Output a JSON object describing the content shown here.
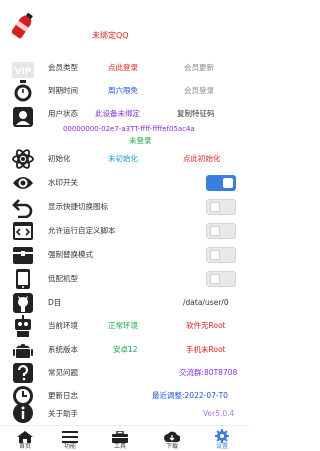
{
  "colors": {
    "red": "#e02020",
    "blue": "#1a56d8",
    "green": "#1aa84a",
    "purple": "#8a2be2",
    "cyan": "#1a9fd8",
    "gray": "#888888",
    "accent": "#3d7de0"
  },
  "header": {
    "user_label": "未绑定QQ",
    "icon": "bottle-icon"
  },
  "membership": {
    "label": "会员类型",
    "value": "点此登录",
    "action": "会员更新",
    "icon": "vip-icon"
  },
  "expiry": {
    "label": "到期时间",
    "value": "周六限免",
    "action": "会员登录",
    "icon": "stopwatch-icon"
  },
  "user_status": {
    "label": "用户状态",
    "value": "此设备未绑定",
    "action": "复制特征码",
    "icon": "user-icon"
  },
  "device_id": {
    "id": "00000000-02e7-a3TT-ffff-ffffef05ac4a",
    "status": "未登录"
  },
  "init": {
    "label": "初始化",
    "value": "未初始化",
    "action": "点此初始化",
    "icon": "atom-icon"
  },
  "toggles": [
    {
      "label": "水印开关",
      "on": true,
      "icon": "eye-icon"
    },
    {
      "label": "显示快捷切换图标",
      "on": false,
      "icon": "undo-icon"
    },
    {
      "label": "允许运行自定义脚本",
      "on": false,
      "icon": "script-icon"
    },
    {
      "label": "强制替换模式",
      "on": false,
      "icon": "box-icon"
    },
    {
      "label": "低配机型",
      "on": false,
      "icon": "phone-icon"
    }
  ],
  "data_path": {
    "label": "D目",
    "value": "/data/user/0",
    "icon": "github-icon"
  },
  "environment": {
    "label": "当前环境",
    "value": "正常环境",
    "extra": "软件无Root",
    "icon": "robot-icon"
  },
  "system": {
    "label": "系统版本",
    "value": "安卓12",
    "extra": "手机未Root",
    "icon": "android-icon"
  },
  "faq": {
    "label": "常见问题",
    "value": "交流群:80T8708",
    "icon": "question-icon"
  },
  "changelog": {
    "label": "更新日志",
    "value": "最近调整:2022-07-T0",
    "icon": "clock-icon"
  },
  "about": {
    "label": "关于助手",
    "value": "Ver5.0.4",
    "icon": "info-icon"
  },
  "nav": [
    {
      "label": "首页",
      "icon": "home-icon"
    },
    {
      "label": "功能",
      "icon": "menu-icon"
    },
    {
      "label": "工具",
      "icon": "toolbox-icon"
    },
    {
      "label": "下载",
      "icon": "cloud-download-icon"
    },
    {
      "label": "设置",
      "icon": "gear-icon",
      "active": true
    }
  ]
}
